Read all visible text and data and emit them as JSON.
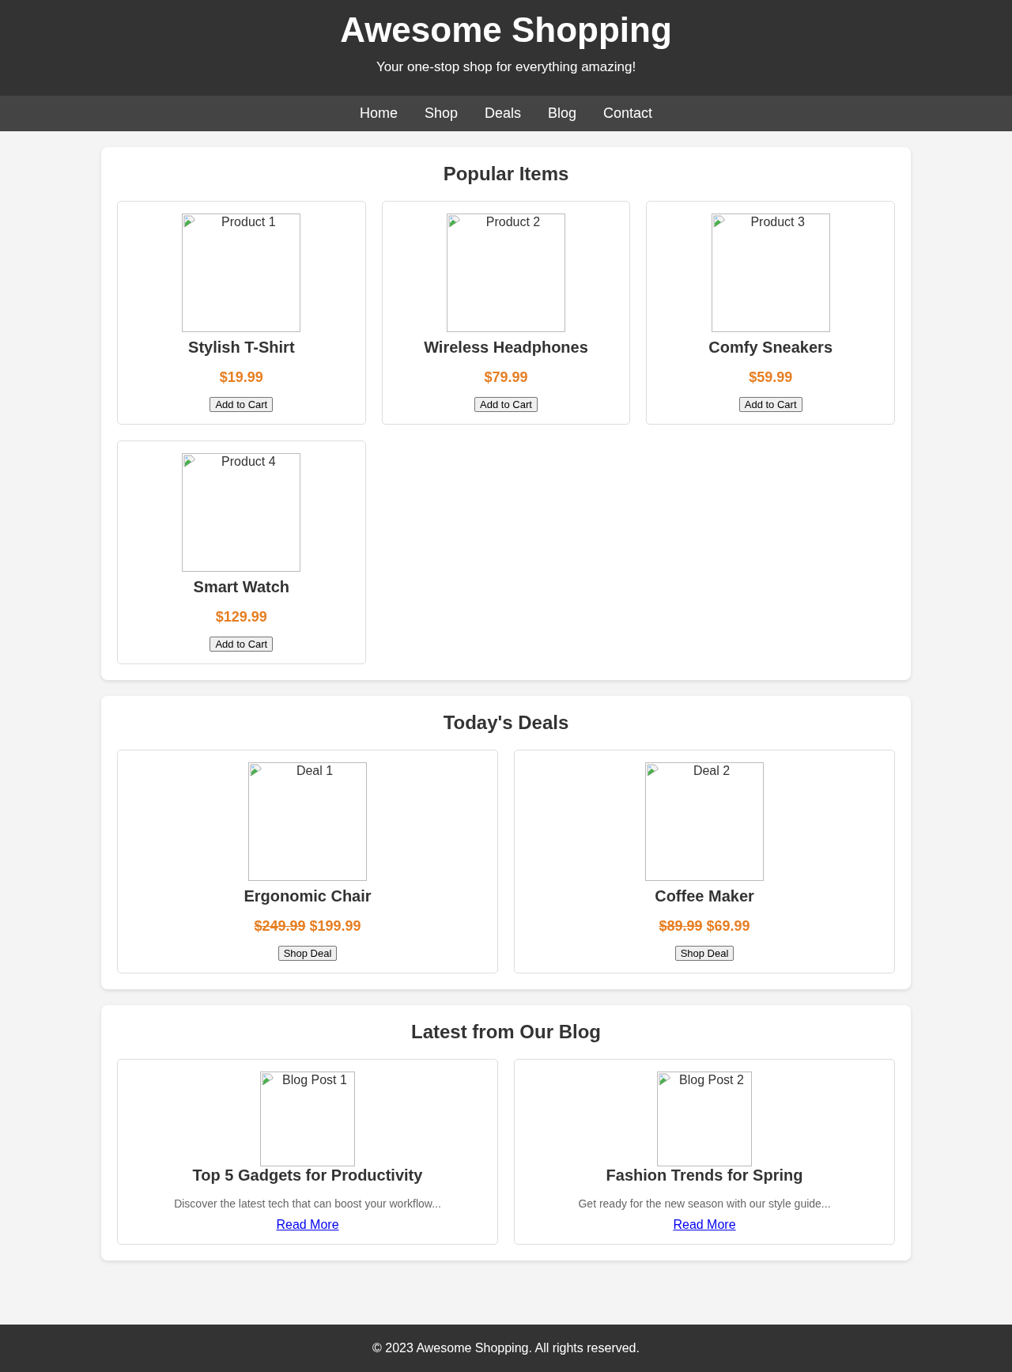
{
  "header": {
    "title": "Awesome Shopping",
    "tagline": "Your one-stop shop for everything amazing!"
  },
  "nav": [
    "Home",
    "Shop",
    "Deals",
    "Blog",
    "Contact"
  ],
  "popular": {
    "title": "Popular Items",
    "items": [
      {
        "image_alt": "Product 1",
        "name": "Stylish T-Shirt",
        "price": "$19.99",
        "button": "Add to Cart"
      },
      {
        "image_alt": "Product 2",
        "name": "Wireless Headphones",
        "price": "$79.99",
        "button": "Add to Cart"
      },
      {
        "image_alt": "Product 3",
        "name": "Comfy Sneakers",
        "price": "$59.99",
        "button": "Add to Cart"
      },
      {
        "image_alt": "Product 4",
        "name": "Smart Watch",
        "price": "$129.99",
        "button": "Add to Cart"
      }
    ]
  },
  "deals": {
    "title": "Today's Deals",
    "items": [
      {
        "image_alt": "Deal 1",
        "name": "Ergonomic Chair",
        "old_price": "$249.99",
        "price": "$199.99",
        "button": "Shop Deal"
      },
      {
        "image_alt": "Deal 2",
        "name": "Coffee Maker",
        "old_price": "$89.99",
        "price": "$69.99",
        "button": "Shop Deal"
      }
    ]
  },
  "blog": {
    "title": "Latest from Our Blog",
    "posts": [
      {
        "image_alt": "Blog Post 1",
        "title": "Top 5 Gadgets for Productivity",
        "excerpt": "Discover the latest tech that can boost your workflow...",
        "link": "Read More"
      },
      {
        "image_alt": "Blog Post 2",
        "title": "Fashion Trends for Spring",
        "excerpt": "Get ready for the new season with our style guide...",
        "link": "Read More"
      }
    ]
  },
  "footer": "© 2023 Awesome Shopping. All rights reserved."
}
